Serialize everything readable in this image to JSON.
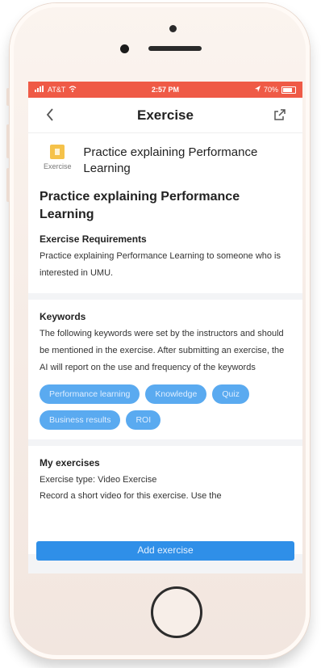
{
  "status_bar": {
    "carrier": "AT&T",
    "time": "2:57 PM",
    "battery": "70%"
  },
  "nav": {
    "title": "Exercise",
    "back_icon": "chevron-left-icon",
    "share_icon": "share-icon"
  },
  "exercise_header": {
    "icon_label": "Exercise",
    "title": "Practice explaining Performance Learning"
  },
  "main_title": "Practice explaining Performance Learning",
  "requirements": {
    "heading": "Exercise Requirements",
    "text": "Practice explaining Performance Learning to someone who is interested in UMU."
  },
  "keywords": {
    "heading": "Keywords",
    "text": "The following keywords were set by the instructors and should be mentioned in the exercise. After submitting an exercise, the AI will report on the use and frequency of the keywords",
    "tags": [
      "Performance learning",
      "Knowledge",
      "Quiz",
      "Business results",
      "ROI"
    ]
  },
  "my_exercises": {
    "heading": "My exercises",
    "type_text": "Exercise type: Video Exercise",
    "instruction": "Record a short video for this exercise. Use the",
    "add_button": "Add exercise"
  },
  "colors": {
    "status_bar": "#ef5a46",
    "tag": "#5aaaf0",
    "button": "#2f8fe8"
  }
}
